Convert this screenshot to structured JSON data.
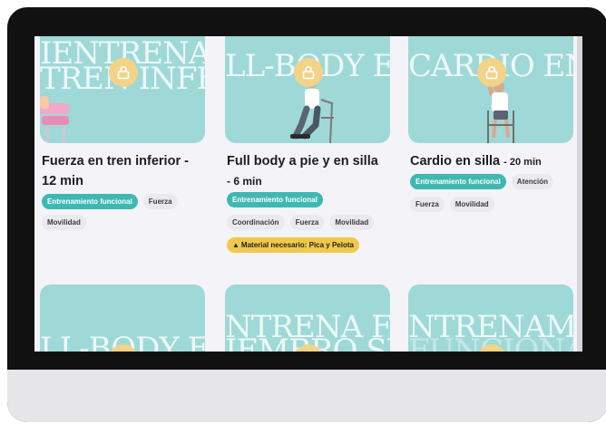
{
  "colors": {
    "accent": "#3fb8b2",
    "thumb": "#9ed9d7",
    "lock": "#f2d388",
    "warning": "#f1c94a"
  },
  "cards": [
    {
      "bg_lines": [
        "IENTRENA TU",
        "TREN INFERIO"
      ],
      "title": "Fuerza en tren inferior -",
      "title_line2": "12 min",
      "duration": "",
      "tags": [
        "Entrenamiento funcional",
        "Fuerza",
        "Movilidad"
      ],
      "warning": ""
    },
    {
      "bg_lines": [
        "LL-BODY EN SIL",
        ""
      ],
      "title": "Full body a pie y en silla",
      "title_line2": "- 6 min",
      "duration": "",
      "tags": [
        "Entrenamiento funcional",
        "Coordinación",
        "Fuerza",
        "Movilidad"
      ],
      "warning": "Material necesario: Pica y Pelota"
    },
    {
      "bg_lines": [
        "CARDIO EN SILL",
        ""
      ],
      "title": "Cardio en silla",
      "title_line2": "",
      "duration": "- 20 min",
      "tags": [
        "Entrenamiento funcional",
        "Atención",
        "Fuerza",
        "Movilidad"
      ],
      "warning": ""
    }
  ],
  "bottom_cards": [
    {
      "bg_lines": [
        "",
        "LL-BODY EN SIL"
      ]
    },
    {
      "bg_lines": [
        "NTRENA FUERZ",
        "IEMBRO SUPERIO"
      ]
    },
    {
      "bg_lines": [
        "NTRENAMIENTO",
        "FUNCIONAL"
      ]
    }
  ]
}
